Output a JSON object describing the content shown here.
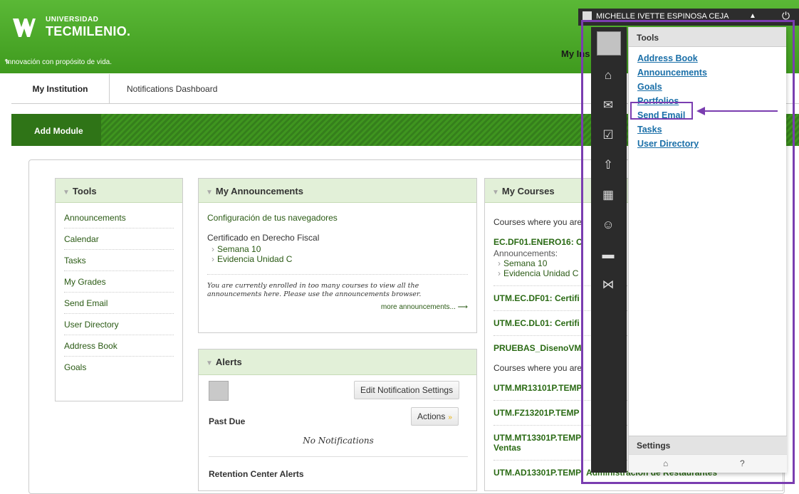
{
  "header": {
    "logo_small": "UNIVERSIDAD",
    "logo_big": "TECMILENIO.",
    "tagline": "Innovación con propósito de vida.",
    "visible_tab": "My Ins"
  },
  "userbar": {
    "name": "MICHELLE IVETTE ESPINOSA CEJA"
  },
  "tabs": {
    "tab1": "My Institution",
    "tab2": "Notifications Dashboard"
  },
  "modbar": {
    "add_module": "Add Module"
  },
  "tools_module": {
    "title": "Tools",
    "items": [
      "Announcements",
      "Calendar",
      "Tasks",
      "My Grades",
      "Send Email",
      "User Directory",
      "Address Book",
      "Goals"
    ]
  },
  "announcements_module": {
    "title": "My Announcements",
    "link1": "Configuración de tus navegadores",
    "course": "Certificado en Derecho Fiscal",
    "sub1": "Semana 10",
    "sub2": "Evidencia Unidad C",
    "note": "You are currently enrolled in too many courses to view all the announcements here. Please use the announcements browser.",
    "more": "more announcements..."
  },
  "alerts_module": {
    "title": "Alerts",
    "edit_button": "Edit Notification Settings",
    "actions_button": "Actions",
    "past_due": "Past Due",
    "no_notifications": "No Notifications",
    "retention": "Retention Center Alerts"
  },
  "courses_module": {
    "title": "My Courses",
    "intro1": "Courses where you are",
    "course1": "EC.DF01.ENERO16: C",
    "ann_label": "Announcements:",
    "ann_sub1": "Semana 10",
    "ann_sub2": "Evidencia Unidad C",
    "course2": "UTM.EC.DF01: Certifi",
    "course3": "UTM.EC.DL01: Certifi",
    "course4": "PRUEBAS_DisenoVM",
    "intro2": "Courses where you are",
    "course5": "UTM.MR13101P.TEMP",
    "course6": "UTM.FZ13201P.TEMP",
    "course7a": "UTM.MT13301P.TEMP",
    "course7b": "Ventas",
    "course8": "UTM.AD13301P.TEMP: Administración de Restaurantes"
  },
  "panel": {
    "header": "Tools",
    "items": [
      "Address Book",
      "Announcements",
      "Goals",
      "Portfolios",
      "Send Email",
      "Tasks",
      "User Directory"
    ],
    "settings": "Settings",
    "help": "?"
  },
  "colors": {
    "brand_green": "#4caf2a",
    "highlight_purple": "#7a3db0",
    "link_blue": "#1a6fa8"
  },
  "icons": [
    "profile-icon",
    "bb-home-icon",
    "messages-icon",
    "grades-icon",
    "updates-icon",
    "calendar-icon",
    "smiley-icon",
    "chat-icon",
    "network-icon",
    "home-icon",
    "power-icon"
  ]
}
